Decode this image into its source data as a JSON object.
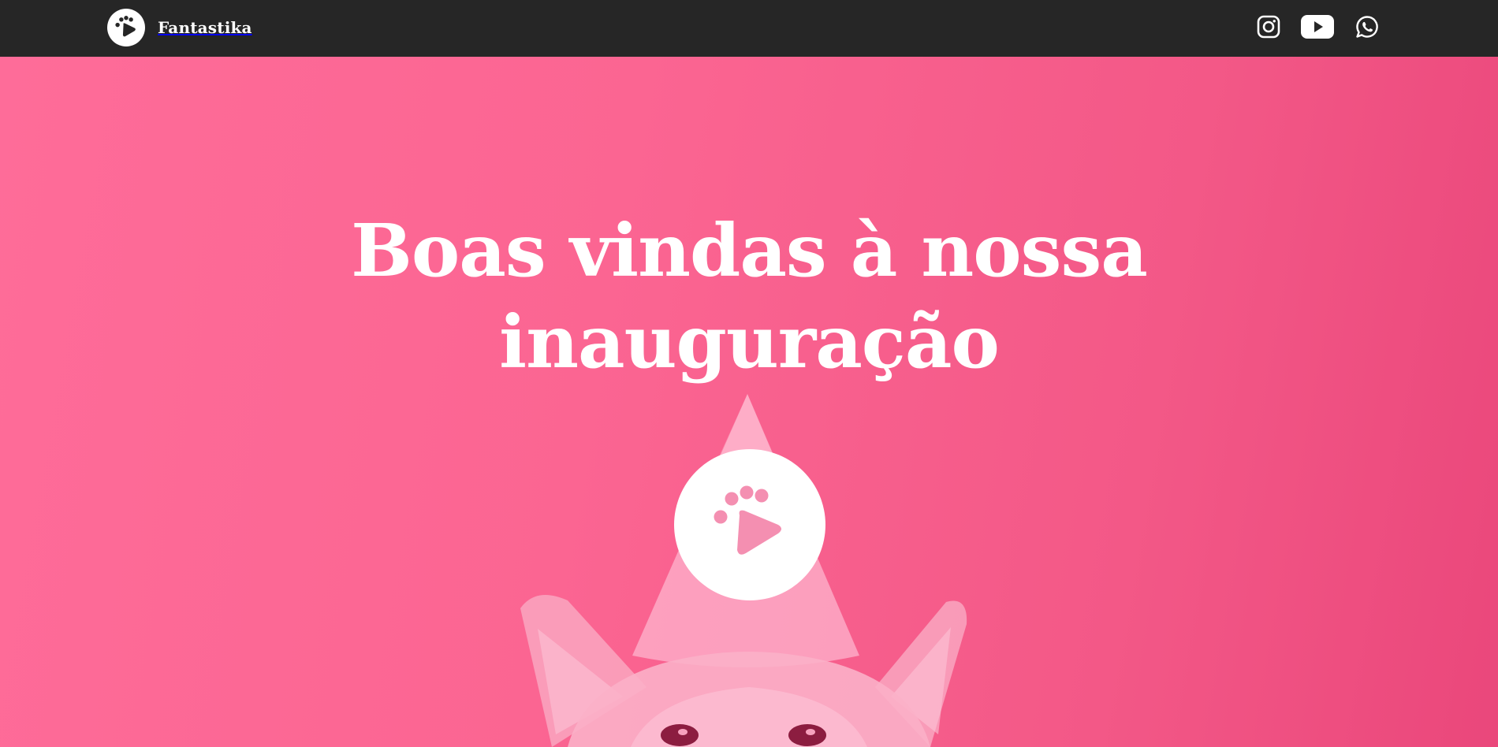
{
  "brand": {
    "name": "Fantastika",
    "logo_icon": "paw-play-icon"
  },
  "social": {
    "items": [
      {
        "name": "instagram",
        "icon": "instagram-icon"
      },
      {
        "name": "youtube",
        "icon": "youtube-icon"
      },
      {
        "name": "whatsapp",
        "icon": "whatsapp-icon"
      }
    ]
  },
  "hero": {
    "title_line1": "Boas vindas à nossa",
    "title_line2": "inauguração",
    "play_icon": "paw-play-icon",
    "image": "dog-with-party-hat"
  },
  "colors": {
    "navbar": "#262626",
    "hero_pink": "#fb6592",
    "hero_pink_dark": "#ea477b",
    "paw_accent": "#f48fb1",
    "text": "#ffffff"
  }
}
